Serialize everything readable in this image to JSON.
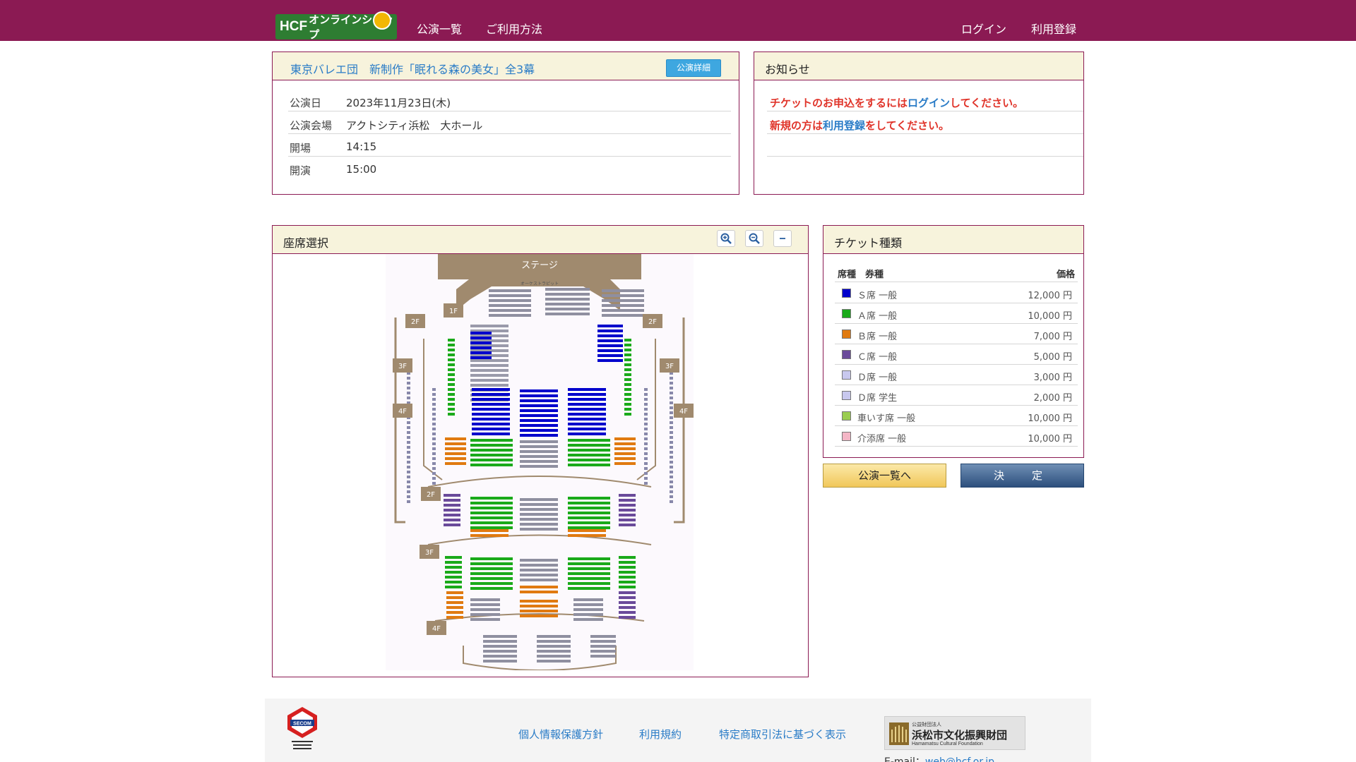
{
  "header": {
    "logo_text": "HCF",
    "logo_subtext": "オンラインショップ",
    "nav": {
      "performances": "公演一覧",
      "how_to_use": "ご利用方法",
      "login": "ログイン",
      "register": "利用登録"
    }
  },
  "performance": {
    "title": "東京バレエ団　新制作「眠れる森の美女」全3幕",
    "detail_button": "公演詳細",
    "rows": [
      {
        "label": "公演日",
        "value": "2023年11月23日(木)"
      },
      {
        "label": "公演会場",
        "value": "アクトシティ浜松　大ホール"
      },
      {
        "label": "開場",
        "value": "14:15"
      },
      {
        "label": "開演",
        "value": "15:00"
      }
    ]
  },
  "notice": {
    "title": "お知らせ",
    "line1": {
      "pre": "チケットのお申込をするには",
      "link": "ログイン",
      "post": "してください。"
    },
    "line2": {
      "pre": "新規の方は",
      "link": "利用登録",
      "post": "をしてください。"
    }
  },
  "seat_map": {
    "title": "座席選択",
    "stage_label": "ステージ",
    "orchestra_label": "オーケストラピット",
    "floor_labels": [
      "1F",
      "2F",
      "2F",
      "3F",
      "3F",
      "4F",
      "4F",
      "2F",
      "3F",
      "4F"
    ]
  },
  "tickets": {
    "title": "チケット種類",
    "col_seat": "席種　券種",
    "col_price": "価格",
    "items": [
      {
        "name": "Ｓ席 一般",
        "price": "12,000 円",
        "color": "#0000cc"
      },
      {
        "name": "Ａ席 一般",
        "price": "10,000 円",
        "color": "#1aaa1a"
      },
      {
        "name": "Ｂ席 一般",
        "price": "7,000 円",
        "color": "#e07a10"
      },
      {
        "name": "Ｃ席 一般",
        "price": "5,000 円",
        "color": "#6a4a9a"
      },
      {
        "name": "Ｄ席 一般",
        "price": "3,000 円",
        "color": "#c8c8ee"
      },
      {
        "name": "Ｄ席 学生",
        "price": "2,000 円",
        "color": "#c8c8ee"
      },
      {
        "name": "車いす席 一般",
        "price": "10,000 円",
        "color": "#9acd50"
      },
      {
        "name": "介添席 一般",
        "price": "10,000 円",
        "color": "#f4b6c6"
      }
    ]
  },
  "buttons": {
    "back_to_list": "公演一覧へ",
    "decide": "決　定"
  },
  "footer": {
    "links": [
      "個人情報保護方針",
      "利用規約",
      "特定商取引法に基づく表示"
    ],
    "foundation_small": "公益財団法人",
    "foundation_name": "浜松市文化振興財団",
    "foundation_en": "Hamamatsu Cultural Foundation",
    "email_label": "E-mail：",
    "email": "web@hcf.or.jp",
    "secom_text": "Secured by SECOM"
  }
}
